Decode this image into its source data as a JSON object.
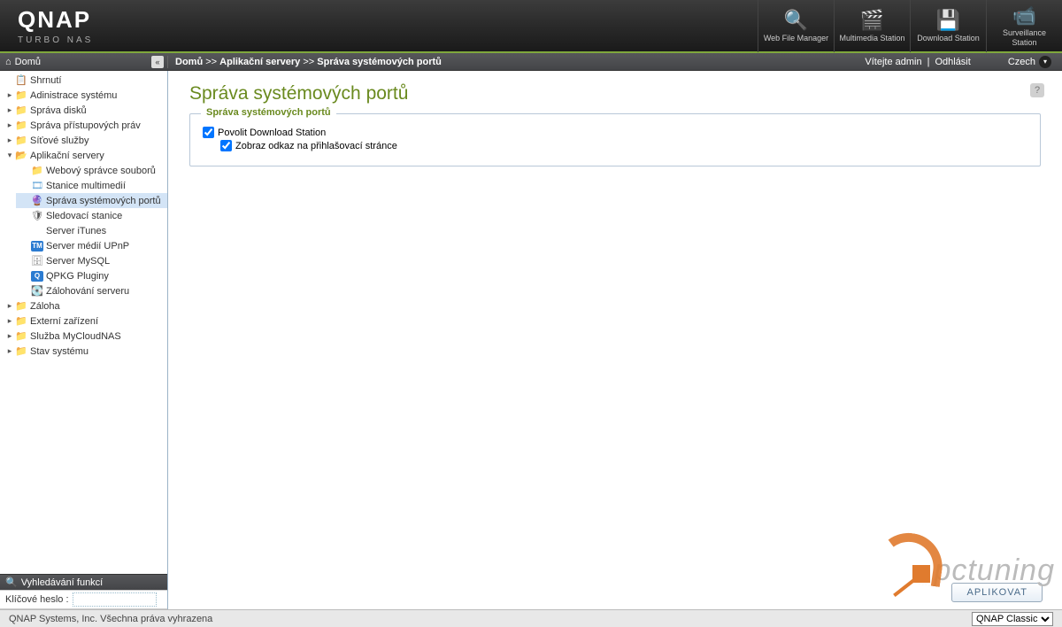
{
  "brand": {
    "name": "QNAP",
    "sub": "TURBO NAS"
  },
  "headerApps": [
    {
      "label": "Web File Manager",
      "icon": "🔍"
    },
    {
      "label": "Multimedia Station",
      "icon": "🎬"
    },
    {
      "label": "Download Station",
      "icon": "💾"
    },
    {
      "label": "Surveillance Station",
      "icon": "📹"
    }
  ],
  "toolbar": {
    "home": "Domů",
    "crumb1": "Domů",
    "sep": ">>",
    "crumb2": "Aplikační servery",
    "crumb3": "Správa systémových portů",
    "welcome": "Vítejte admin",
    "logout": "Odhlásit",
    "lang": "Czech"
  },
  "sidebar": {
    "items": [
      {
        "label": "Shrnutí",
        "expand": "",
        "iconClass": "",
        "emoji": "📋"
      },
      {
        "label": "Adinistrace systému",
        "expand": "▸",
        "iconClass": "fld",
        "emoji": "📁"
      },
      {
        "label": "Správa disků",
        "expand": "▸",
        "iconClass": "fld",
        "emoji": "📁"
      },
      {
        "label": "Správa přístupových práv",
        "expand": "▸",
        "iconClass": "fld",
        "emoji": "📁"
      },
      {
        "label": "Síťové služby",
        "expand": "▸",
        "iconClass": "fld",
        "emoji": "📁"
      },
      {
        "label": "Aplikační servery",
        "expand": "▾",
        "iconClass": "fld-open",
        "emoji": "📂"
      },
      {
        "label": "Záloha",
        "expand": "▸",
        "iconClass": "fld",
        "emoji": "📁"
      },
      {
        "label": "Externí zařízení",
        "expand": "▸",
        "iconClass": "fld",
        "emoji": "📁"
      },
      {
        "label": "Služba MyCloudNAS",
        "expand": "▸",
        "iconClass": "fld",
        "emoji": "📁"
      },
      {
        "label": "Stav systému",
        "expand": "▸",
        "iconClass": "fld",
        "emoji": "📁"
      }
    ],
    "appServers": [
      {
        "label": "Webový správce souborů",
        "emoji": "📁",
        "iconColor": "#e6a23c"
      },
      {
        "label": "Stanice multimedií",
        "emoji": "🎞",
        "iconColor": "#6aa9d9"
      },
      {
        "label": "Správa systémových portů",
        "emoji": "🔮",
        "iconColor": "#b05da8",
        "selected": true
      },
      {
        "label": "Sledovací stanice",
        "emoji": "🛡",
        "iconColor": "#555"
      },
      {
        "label": "Server iTunes",
        "emoji": "",
        "iconColor": "#888"
      },
      {
        "label": "Server médií UPnP",
        "emoji": "TM",
        "iconColor": "#2b7bd1",
        "box": true
      },
      {
        "label": "Server MySQL",
        "emoji": "🗄",
        "iconColor": "#888"
      },
      {
        "label": "QPKG Pluginy",
        "emoji": "Q",
        "iconColor": "#2b7bd1",
        "box": true
      },
      {
        "label": "Zálohování serveru",
        "emoji": "💽",
        "iconColor": "#666"
      }
    ],
    "searchHeader": "Vyhledávání funkcí",
    "searchLabel": "Klíčové heslo :"
  },
  "page": {
    "title": "Správa systémových portů",
    "legend": "Správa systémových portů",
    "chk1": "Povolit Download Station",
    "chk2": "Zobraz odkaz na přihlašovací stránce",
    "apply": "APLIKOVAT"
  },
  "footer": {
    "copyright": "QNAP Systems, Inc. Všechna práva vyhrazena",
    "theme": "QNAP Classic"
  },
  "watermark": "pctuning"
}
